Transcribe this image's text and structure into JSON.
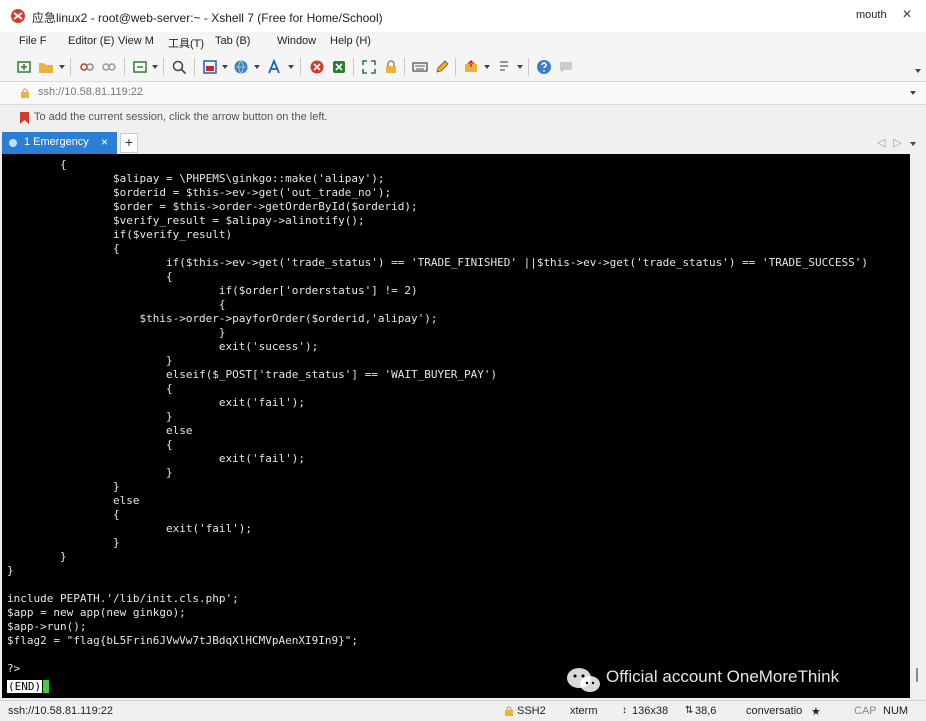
{
  "window": {
    "title": "应急linux2 - root@web-server:~ - Xshell 7 (Free for Home/School)",
    "user": "mouth",
    "close_glyph": "×"
  },
  "menu": {
    "file": "File F",
    "editor": "Editor (E)",
    "view": "View M",
    "tools": "工具(T)",
    "tab": "Tab (B)",
    "window": "Window",
    "help": "Help (H)"
  },
  "address": {
    "value": "ssh://10.58.81.119:22"
  },
  "hint": {
    "text": "To add the current session, click the arrow button on the left."
  },
  "tabs": {
    "active_label": "1 Emergency",
    "close_glyph": "×",
    "add_glyph": "+",
    "nav_left": "◁",
    "nav_right": "▷"
  },
  "terminal": {
    "lines": [
      "\t{",
      "\t\t$alipay = \\PHPEMS\\ginkgo::make('alipay');",
      "\t\t$orderid = $this->ev->get('out_trade_no');",
      "\t\t$order = $this->order->getOrderById($orderid);",
      "\t\t$verify_result = $alipay->alinotify();",
      "\t\tif($verify_result)",
      "\t\t{",
      "\t\t\tif($this->ev->get('trade_status') == 'TRADE_FINISHED' ||$this->ev->get('trade_status') == 'TRADE_SUCCESS')",
      "\t\t\t{",
      "\t\t\t\tif($order['orderstatus'] != 2)",
      "\t\t\t\t{",
      "\t\t    $this->order->payforOrder($orderid,'alipay');",
      "\t\t\t\t}",
      "\t\t\t\texit('sucess');",
      "\t\t\t}",
      "\t\t\telseif($_POST['trade_status'] == 'WAIT_BUYER_PAY')",
      "\t\t\t{",
      "\t\t\t\texit('fail');",
      "\t\t\t}",
      "\t\t\telse",
      "\t\t\t{",
      "\t\t\t\texit('fail');",
      "\t\t\t}",
      "\t\t}",
      "\t\telse",
      "\t\t{",
      "\t\t\texit('fail');",
      "\t\t}",
      "\t}",
      "}",
      "",
      "include PEPATH.'/lib/init.cls.php';",
      "$app = new app(new ginkgo);",
      "$app->run();",
      "$flag2 = \"flag{bL5Frin6JVwVw7tJBdqXlHCMVpAenXI9In9}\";",
      "",
      "?>"
    ],
    "end_marker": "(END)"
  },
  "watermark": {
    "text": "Official account OneMoreThink"
  },
  "status": {
    "address": "ssh://10.58.81.119:22",
    "protocol": "SSH2",
    "terminal_type": "xterm",
    "size": "136x38",
    "cursor_pos": "38,6",
    "session_mode": "conversatio",
    "star": "★",
    "cap": "CAP",
    "num": "NUM"
  },
  "colors": {
    "tab_active": "#2a7fd4",
    "terminal_bg": "#000000",
    "terminal_fg": "#e6e6e6",
    "cursor": "#3dd13d"
  }
}
